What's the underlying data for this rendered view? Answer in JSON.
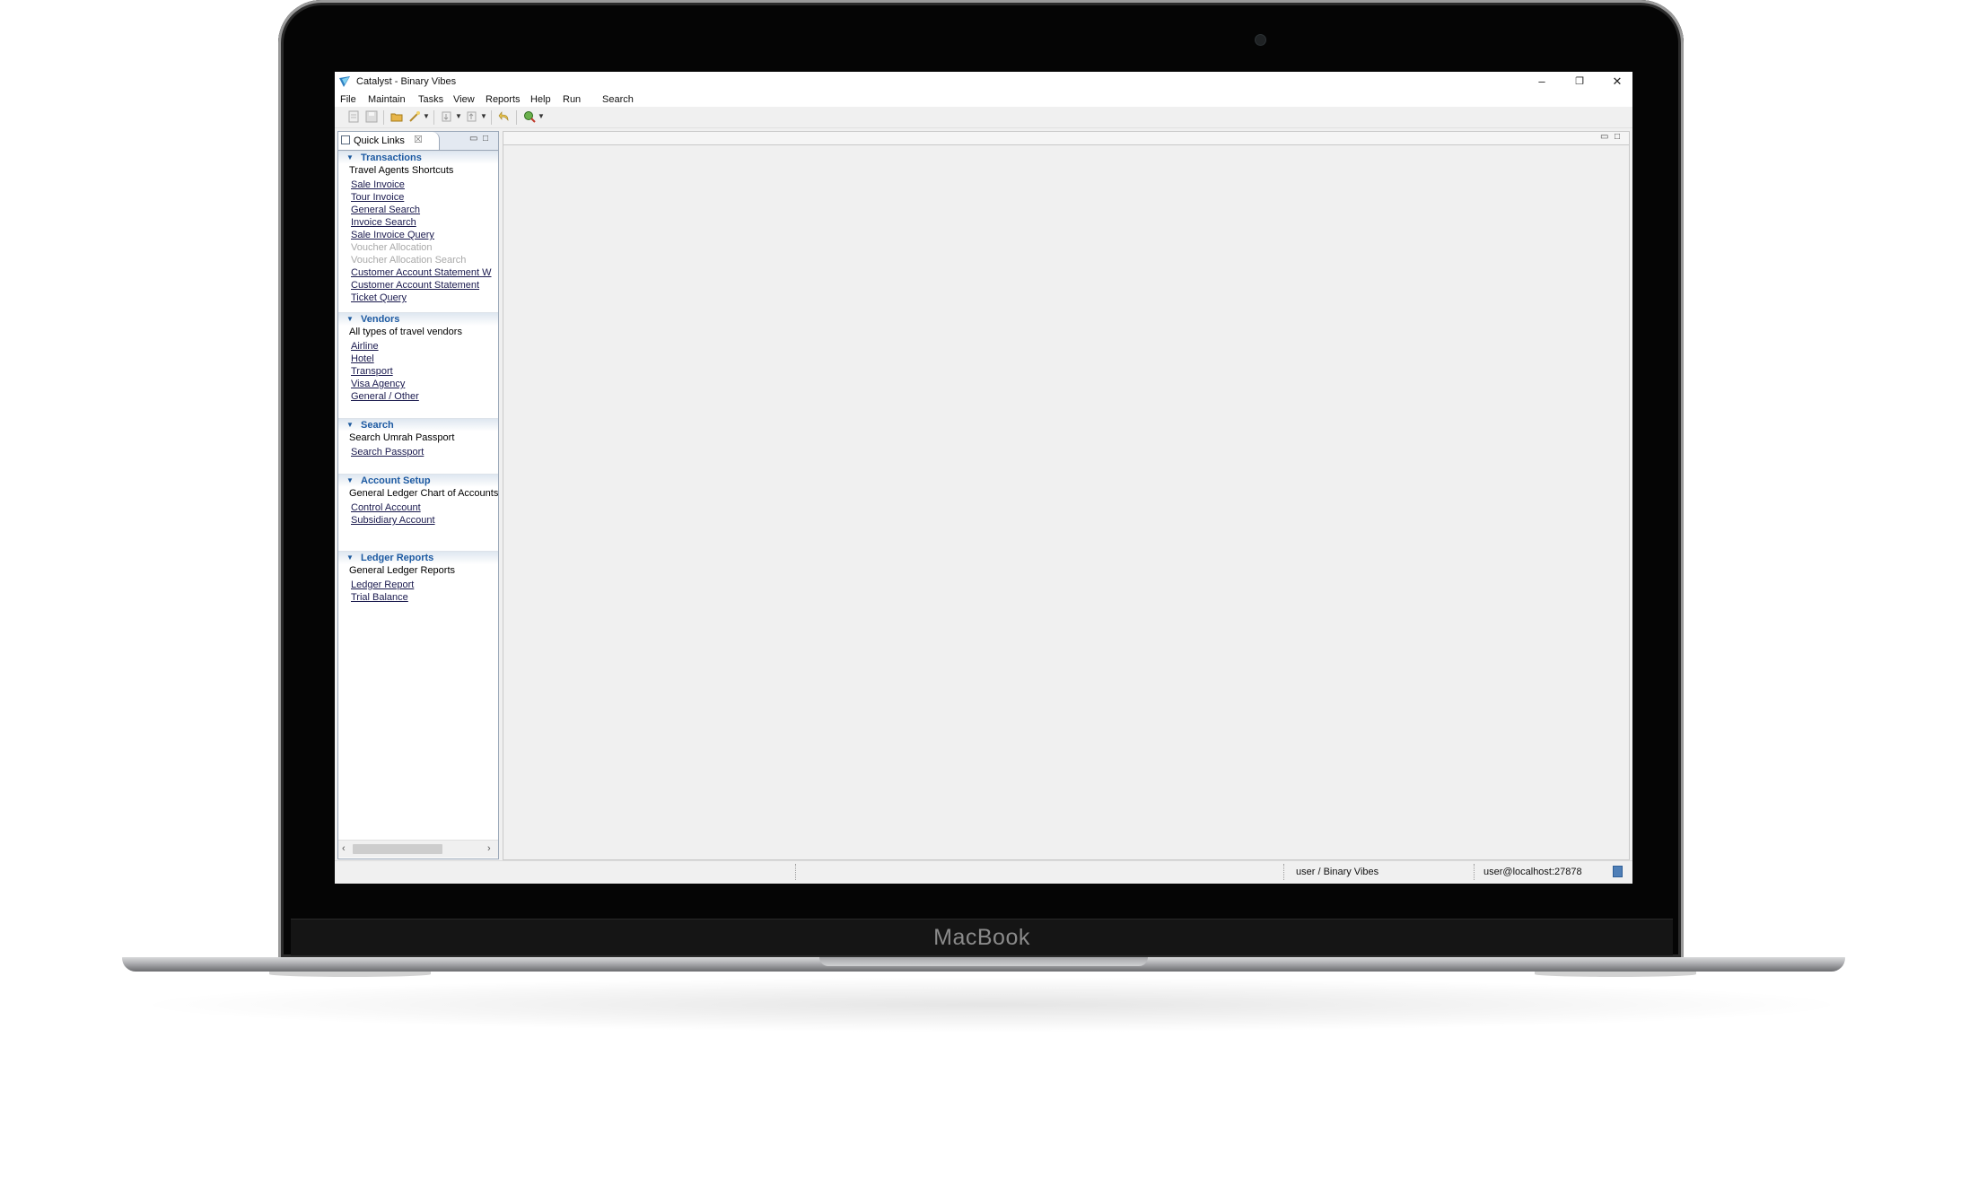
{
  "device": {
    "brand_label": "MacBook"
  },
  "window": {
    "title": "Catalyst - Binary Vibes",
    "controls": {
      "minimize": "–",
      "restore": "❐",
      "close": "✕"
    }
  },
  "menu": [
    "File",
    "Maintain",
    "Tasks",
    "View",
    "Reports",
    "Help",
    "Run",
    "Search"
  ],
  "toolbar": {
    "icons": [
      "new-icon",
      "save-icon",
      "open-folder-icon",
      "wand-icon",
      "import-icon",
      "export-icon",
      "undo-icon",
      "run-search-icon"
    ]
  },
  "quick_links": {
    "tab_title": "Quick Links",
    "tab_close": "☒",
    "minimize": "▭",
    "maximize": "□",
    "sections": [
      {
        "title": "Transactions",
        "description": "Travel Agents Shortcuts",
        "links": [
          {
            "label": "Sale Invoice",
            "enabled": true
          },
          {
            "label": "Tour Invoice",
            "enabled": true
          },
          {
            "label": "General Search",
            "enabled": true
          },
          {
            "label": "Invoice Search",
            "enabled": true
          },
          {
            "label": "Sale Invoice Query",
            "enabled": true
          },
          {
            "label": "Voucher Allocation",
            "enabled": false
          },
          {
            "label": "Voucher Allocation Search",
            "enabled": false
          },
          {
            "label": "Customer Account Statement W",
            "enabled": true
          },
          {
            "label": "Customer Account Statement",
            "enabled": true
          },
          {
            "label": "Ticket Query",
            "enabled": true
          }
        ]
      },
      {
        "title": "Vendors",
        "description": "All types of travel vendors",
        "links": [
          {
            "label": "Airline",
            "enabled": true
          },
          {
            "label": "Hotel",
            "enabled": true
          },
          {
            "label": "Transport",
            "enabled": true
          },
          {
            "label": "Visa Agency",
            "enabled": true
          },
          {
            "label": "General / Other",
            "enabled": true
          }
        ]
      },
      {
        "title": "Search",
        "description": "Search Umrah Passport",
        "links": [
          {
            "label": "Search Passport",
            "enabled": true
          }
        ]
      },
      {
        "title": "Account Setup",
        "description": "General Ledger Chart of Accounts",
        "links": [
          {
            "label": "Control Account",
            "enabled": true
          },
          {
            "label": "Subsidiary Account",
            "enabled": true
          }
        ]
      },
      {
        "title": "Ledger Reports",
        "description": "General Ledger Reports",
        "links": [
          {
            "label": "Ledger Report",
            "enabled": true
          },
          {
            "label": "Trial Balance",
            "enabled": true
          }
        ]
      }
    ]
  },
  "editor": {
    "minimize": "▭",
    "maximize": "□"
  },
  "statusbar": {
    "user": "user / Binary Vibes",
    "server": "user@localhost:27878"
  }
}
